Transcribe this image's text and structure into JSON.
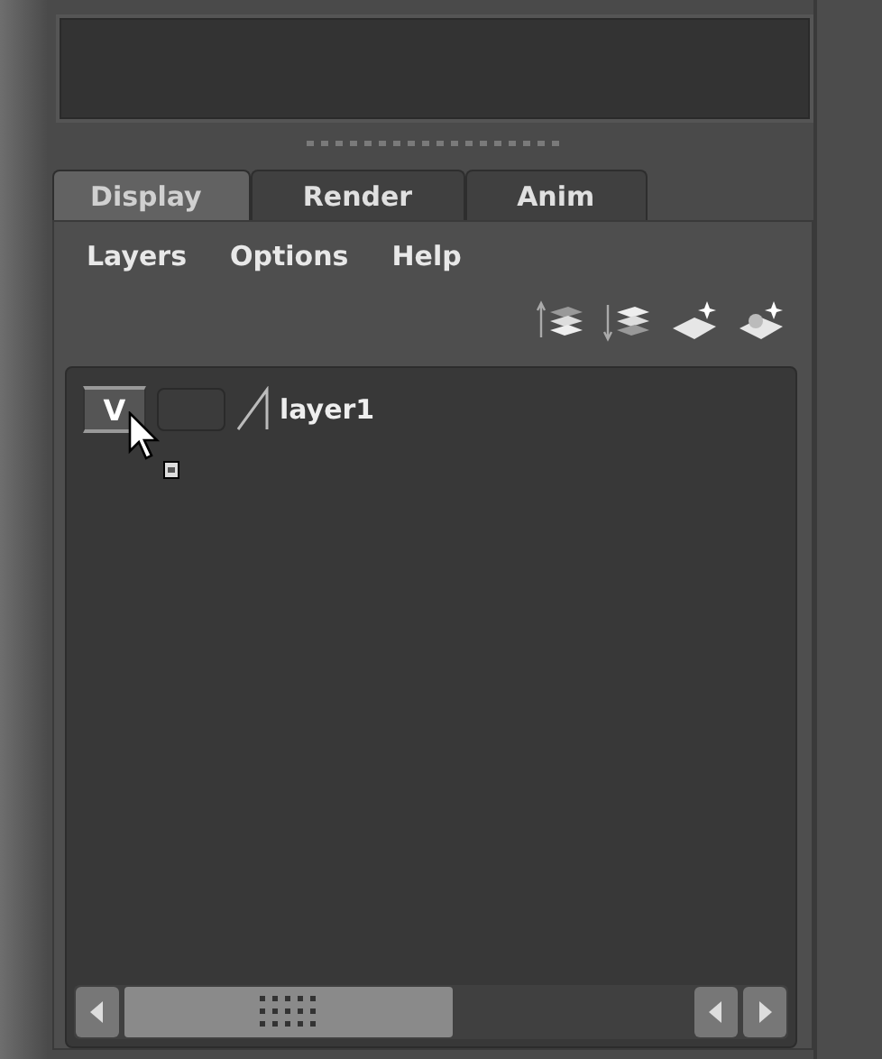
{
  "tabs": [
    {
      "label": "Display",
      "selected": true
    },
    {
      "label": "Render",
      "selected": false
    },
    {
      "label": "Anim",
      "selected": false
    }
  ],
  "menu": [
    "Layers",
    "Options",
    "Help"
  ],
  "toolbar": [
    {
      "kind": "move-up"
    },
    {
      "kind": "move-down"
    },
    {
      "kind": "new-layer"
    },
    {
      "kind": "new-layer-selected"
    }
  ],
  "layers": [
    {
      "visibility": "V",
      "visible": true,
      "templated": false,
      "name": "layer1"
    }
  ]
}
